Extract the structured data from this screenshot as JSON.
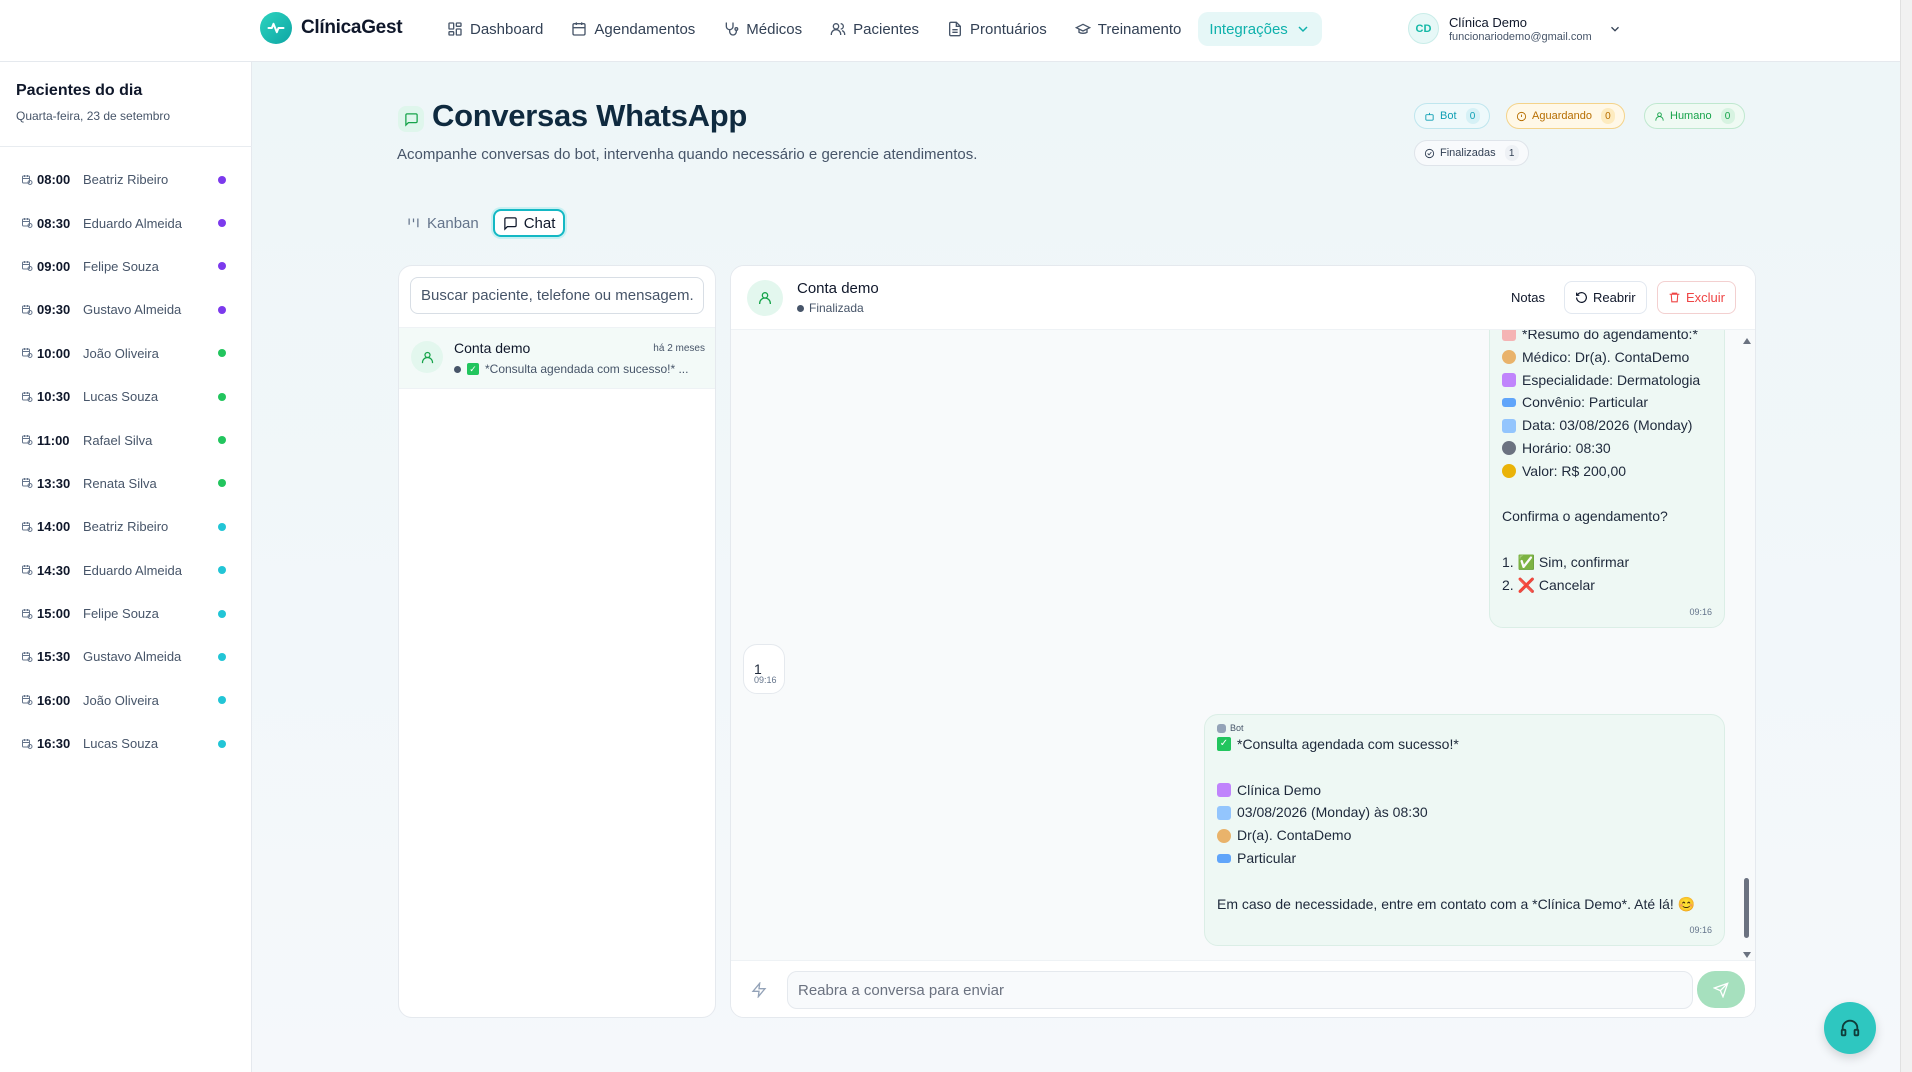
{
  "app": {
    "name": "ClínicaGest"
  },
  "nav": {
    "items": [
      {
        "label": "Dashboard",
        "icon": "dashboard-icon"
      },
      {
        "label": "Agendamentos",
        "icon": "calendar-icon"
      },
      {
        "label": "Médicos",
        "icon": "stethoscope-icon"
      },
      {
        "label": "Pacientes",
        "icon": "users-icon"
      },
      {
        "label": "Prontuários",
        "icon": "file-icon"
      },
      {
        "label": "Treinamento",
        "icon": "graduation-icon"
      },
      {
        "label": "Integrações",
        "icon": "chevron-down-icon"
      }
    ]
  },
  "user": {
    "initials": "CD",
    "name": "Clínica Demo",
    "email": "funcionariodemo@gmail.com"
  },
  "sidebar": {
    "title": "Pacientes do dia",
    "date": "Quarta-feira, 23 de setembro",
    "appointments": [
      {
        "time": "08:00",
        "name": "Beatriz Ribeiro",
        "color": "#7c3aed"
      },
      {
        "time": "08:30",
        "name": "Eduardo Almeida",
        "color": "#7c3aed"
      },
      {
        "time": "09:00",
        "name": "Felipe Souza",
        "color": "#7c3aed"
      },
      {
        "time": "09:30",
        "name": "Gustavo Almeida",
        "color": "#7c3aed"
      },
      {
        "time": "10:00",
        "name": "João Oliveira",
        "color": "#22c55e"
      },
      {
        "time": "10:30",
        "name": "Lucas Souza",
        "color": "#22c55e"
      },
      {
        "time": "11:00",
        "name": "Rafael Silva",
        "color": "#22c55e"
      },
      {
        "time": "13:30",
        "name": "Renata Silva",
        "color": "#22c55e"
      },
      {
        "time": "14:00",
        "name": "Beatriz Ribeiro",
        "color": "#22c5d6"
      },
      {
        "time": "14:30",
        "name": "Eduardo Almeida",
        "color": "#22c5d6"
      },
      {
        "time": "15:00",
        "name": "Felipe Souza",
        "color": "#22c5d6"
      },
      {
        "time": "15:30",
        "name": "Gustavo Almeida",
        "color": "#22c5d6"
      },
      {
        "time": "16:00",
        "name": "João Oliveira",
        "color": "#22c5d6"
      },
      {
        "time": "16:30",
        "name": "Lucas Souza",
        "color": "#22c5d6"
      }
    ]
  },
  "page": {
    "title": "Conversas WhatsApp",
    "description": "Acompanhe conversas do bot, intervenha quando necessário e gerencie atendimentos."
  },
  "status_pills": {
    "bot": {
      "label": "Bot",
      "count": "0"
    },
    "aguardando": {
      "label": "Aguardando",
      "count": "0"
    },
    "humano": {
      "label": "Humano",
      "count": "0"
    },
    "finalizadas": {
      "label": "Finalizadas",
      "count": "1"
    }
  },
  "view_toggle": {
    "kanban": "Kanban",
    "chat": "Chat"
  },
  "conversations": {
    "search_placeholder": "Buscar paciente, telefone ou mensagem...",
    "items": [
      {
        "name": "Conta demo",
        "time": "há 2 meses",
        "snippet": "*Consulta agendada com sucesso!* ..."
      }
    ]
  },
  "chat": {
    "contact": "Conta demo",
    "status": "Finalizada",
    "actions": {
      "notes": "Notas",
      "reopen": "Reabrir",
      "delete": "Excluir"
    },
    "msg1": {
      "partial_top": "*Resumo do agendamento:*",
      "lines": [
        "Médico: Dr(a). ContaDemo",
        "Especialidade: Dermatologia",
        "Convênio: Particular",
        "Data: 03/08/2026 (Monday)",
        "Horário: 08:30",
        "Valor: R$ 200,00"
      ],
      "question": "Confirma o agendamento?",
      "option1": "1. ✅ Sim, confirmar",
      "option2": "2. ❌ Cancelar",
      "time": "09:16"
    },
    "msg2": {
      "text": "1",
      "time": "09:16"
    },
    "msg3": {
      "tag": "Bot",
      "headline": "*Consulta agendada com sucesso!*",
      "lines": [
        "Clínica Demo",
        "03/08/2026 (Monday) às 08:30",
        "Dr(a). ContaDemo",
        "Particular"
      ],
      "footer": "Em caso de necessidade, entre em contato com a *Clínica Demo*. Até lá! 😊",
      "time": "09:16"
    },
    "composer_placeholder": "Reabra a conversa para enviar"
  }
}
